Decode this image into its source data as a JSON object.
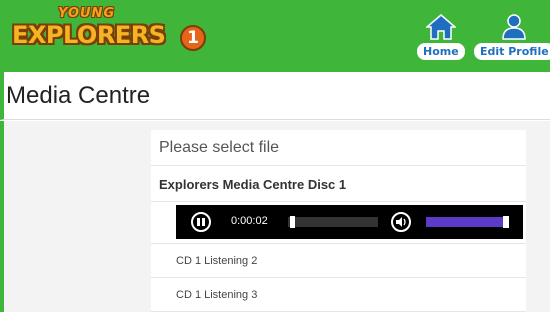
{
  "header": {
    "logo": {
      "young": "YOUNG",
      "explorers": "EXPLORERS",
      "level": "1"
    },
    "home_label": "Home",
    "profile_label": "Edit Profile",
    "accent_color": "#3fb63a",
    "button_text_color": "#1e6fc0"
  },
  "page": {
    "title": "Media Centre"
  },
  "panel": {
    "heading": "Please select file",
    "disc_title": "Explorers Media Centre Disc 1",
    "player": {
      "time": "0:00:02",
      "state_icon": "pause-icon",
      "volume_icon": "speaker-icon",
      "progress_fraction": 0.02,
      "volume_fraction": 1.0,
      "volume_color": "#5a3cc8"
    },
    "tracks": [
      {
        "label": "CD 1 Listening 2"
      },
      {
        "label": "CD 1 Listening 3"
      }
    ]
  }
}
